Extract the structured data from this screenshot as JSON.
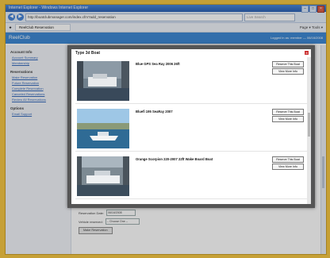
{
  "browser": {
    "title": "Internet Explorer - Windows Internet Explorer",
    "url": "http://boatclubmanager.com/index.cfm?add_reservation",
    "search_placeholder": "Live Search",
    "tab_label": "ReelClub Reservation",
    "tools_label": "Page ▾  Tools ▾"
  },
  "app": {
    "name": "ReelClub",
    "user_info": "Logged in as: member — 06/16/2008"
  },
  "sidebar": {
    "sections": [
      {
        "title": "Account Info",
        "links": [
          "Account Summary",
          "Membership"
        ]
      },
      {
        "title": "Reservations",
        "links": [
          "Make Reservation",
          "Future Reservation",
          "Complete Reservation",
          "Canceled Reservations",
          "Review All Reservations"
        ]
      },
      {
        "title": "Options",
        "links": [
          "Email Support"
        ]
      }
    ]
  },
  "modal": {
    "title": "Type 3d Boat",
    "items": [
      {
        "name": "Blue GPS Sea Ray 2006 26ft",
        "btn_reserve": "Reserve This Boat",
        "btn_info": "View More Info"
      },
      {
        "name": "Bluefi 195 SeaRay 2007",
        "btn_reserve": "Reserve This Boat",
        "btn_info": "View More Info"
      },
      {
        "name": "Orange Scorpion 220-2007 22ft Wake Board Boat",
        "btn_reserve": "Reserve This Boat",
        "btn_info": "View More Info"
      }
    ]
  },
  "form": {
    "date_label": "Reservation Date:",
    "date_value": "06/16/2008",
    "vehicle_label": "Vehicle reserved:",
    "vehicle_value": "-- Choose One --",
    "submit_label": "Make Reservation"
  },
  "colors": {
    "background": "#f4c235",
    "header": "#2f7fd0",
    "link": "#2a62b8"
  }
}
